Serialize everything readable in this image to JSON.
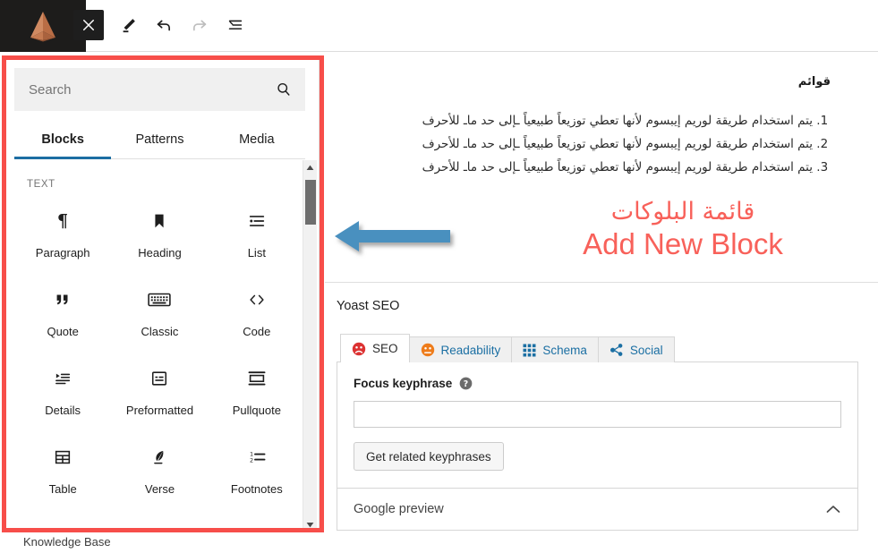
{
  "colors": {
    "annotation_red": "#f74e4a",
    "caption_red": "#f8615a",
    "arrow_blue": "#4a90bf",
    "tab_active_underline": "#1d6ea3",
    "yoast_link_blue": "#1b6fa3",
    "logo_copper": "#c07a52"
  },
  "topbar": {
    "logo_name": "pyramid-logo",
    "buttons": [
      {
        "name": "close-inserter-button",
        "icon": "close-icon",
        "label": "Close"
      },
      {
        "name": "edit-tool-button",
        "icon": "pencil-icon",
        "label": "Edit"
      },
      {
        "name": "undo-button",
        "icon": "undo-icon",
        "label": "Undo"
      },
      {
        "name": "redo-button",
        "icon": "redo-icon",
        "label": "Redo"
      },
      {
        "name": "document-overview-button",
        "icon": "list-view-icon",
        "label": "Document Overview"
      }
    ]
  },
  "inserter": {
    "search": {
      "placeholder": "Search",
      "value": "",
      "icon": "search-icon"
    },
    "tabs": [
      {
        "label": "Blocks",
        "active": true
      },
      {
        "label": "Patterns",
        "active": false
      },
      {
        "label": "Media",
        "active": false
      }
    ],
    "section_title": "TEXT",
    "blocks": [
      {
        "label": "Paragraph",
        "icon": "paragraph-icon"
      },
      {
        "label": "Heading",
        "icon": "heading-bookmark-icon"
      },
      {
        "label": "List",
        "icon": "list-icon"
      },
      {
        "label": "Quote",
        "icon": "quote-icon"
      },
      {
        "label": "Classic",
        "icon": "keyboard-icon"
      },
      {
        "label": "Code",
        "icon": "code-brackets-icon"
      },
      {
        "label": "Details",
        "icon": "details-icon"
      },
      {
        "label": "Preformatted",
        "icon": "preformatted-icon"
      },
      {
        "label": "Pullquote",
        "icon": "pullquote-icon"
      },
      {
        "label": "Table",
        "icon": "table-icon"
      },
      {
        "label": "Verse",
        "icon": "feather-icon"
      },
      {
        "label": "Footnotes",
        "icon": "footnotes-icon"
      }
    ],
    "scrollbar": {
      "up_arrow": "scroll-up-arrow-icon",
      "down_arrow": "scroll-down-arrow-icon"
    }
  },
  "post": {
    "heading": "قوائم",
    "list_items": [
      "يتم استخدام طريقة لوريم إيبسوم لأنها تعطي توزيعاً طبيعياً ـإلى حد ماـ للأحرف",
      "يتم استخدام طريقة لوريم إيبسوم لأنها تعطي توزيعاً طبيعياً ـإلى حد ماـ للأحرف",
      "يتم استخدام طريقة لوريم إيبسوم لأنها تعطي توزيعاً طبيعياً ـإلى حد ماـ للأحرف"
    ]
  },
  "annotation": {
    "arabic_caption": "قائمة البلوكات",
    "english_caption": "Add New Block",
    "arrow_icon": "left-arrow-annotation"
  },
  "yoast": {
    "title": "Yoast SEO",
    "tabs": [
      {
        "label": "SEO",
        "icon": "seo-face-bad-icon",
        "active": true
      },
      {
        "label": "Readability",
        "icon": "readability-face-ok-icon",
        "active": false
      },
      {
        "label": "Schema",
        "icon": "schema-grid-icon",
        "active": false
      },
      {
        "label": "Social",
        "icon": "social-share-icon",
        "active": false
      }
    ],
    "focus_keyphrase_label": "Focus keyphrase",
    "focus_keyphrase_value": "",
    "help_icon": "help-question-icon",
    "related_keyphrases_button": "Get related keyphrases",
    "google_preview_label": "Google preview",
    "google_preview_toggle_icon": "chevron-up-icon"
  },
  "footer": {
    "knowledge_base": "Knowledge Base"
  }
}
